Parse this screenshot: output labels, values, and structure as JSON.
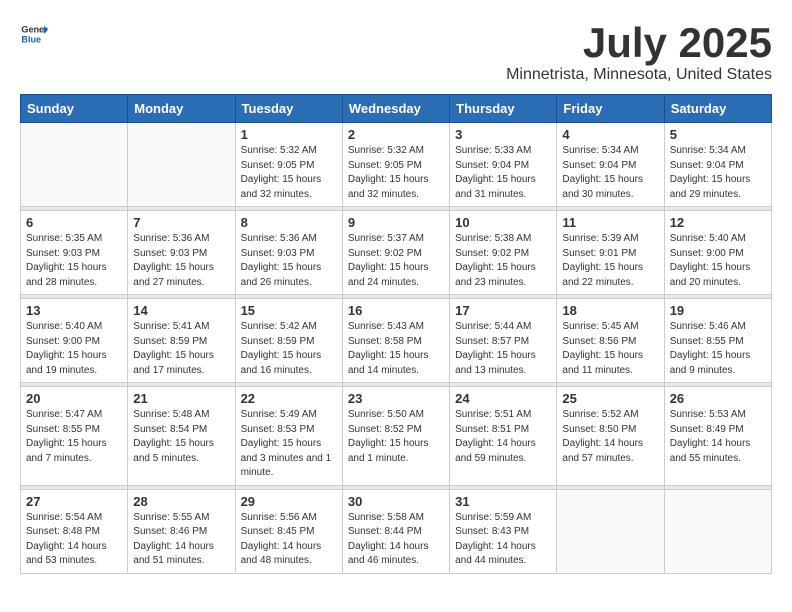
{
  "logo": {
    "general": "General",
    "blue": "Blue"
  },
  "title": "July 2025",
  "subtitle": "Minnetrista, Minnesota, United States",
  "days_of_week": [
    "Sunday",
    "Monday",
    "Tuesday",
    "Wednesday",
    "Thursday",
    "Friday",
    "Saturday"
  ],
  "weeks": [
    [
      {
        "day": "",
        "detail": ""
      },
      {
        "day": "",
        "detail": ""
      },
      {
        "day": "1",
        "detail": "Sunrise: 5:32 AM\nSunset: 9:05 PM\nDaylight: 15 hours\nand 32 minutes."
      },
      {
        "day": "2",
        "detail": "Sunrise: 5:32 AM\nSunset: 9:05 PM\nDaylight: 15 hours\nand 32 minutes."
      },
      {
        "day": "3",
        "detail": "Sunrise: 5:33 AM\nSunset: 9:04 PM\nDaylight: 15 hours\nand 31 minutes."
      },
      {
        "day": "4",
        "detail": "Sunrise: 5:34 AM\nSunset: 9:04 PM\nDaylight: 15 hours\nand 30 minutes."
      },
      {
        "day": "5",
        "detail": "Sunrise: 5:34 AM\nSunset: 9:04 PM\nDaylight: 15 hours\nand 29 minutes."
      }
    ],
    [
      {
        "day": "6",
        "detail": "Sunrise: 5:35 AM\nSunset: 9:03 PM\nDaylight: 15 hours\nand 28 minutes."
      },
      {
        "day": "7",
        "detail": "Sunrise: 5:36 AM\nSunset: 9:03 PM\nDaylight: 15 hours\nand 27 minutes."
      },
      {
        "day": "8",
        "detail": "Sunrise: 5:36 AM\nSunset: 9:03 PM\nDaylight: 15 hours\nand 26 minutes."
      },
      {
        "day": "9",
        "detail": "Sunrise: 5:37 AM\nSunset: 9:02 PM\nDaylight: 15 hours\nand 24 minutes."
      },
      {
        "day": "10",
        "detail": "Sunrise: 5:38 AM\nSunset: 9:02 PM\nDaylight: 15 hours\nand 23 minutes."
      },
      {
        "day": "11",
        "detail": "Sunrise: 5:39 AM\nSunset: 9:01 PM\nDaylight: 15 hours\nand 22 minutes."
      },
      {
        "day": "12",
        "detail": "Sunrise: 5:40 AM\nSunset: 9:00 PM\nDaylight: 15 hours\nand 20 minutes."
      }
    ],
    [
      {
        "day": "13",
        "detail": "Sunrise: 5:40 AM\nSunset: 9:00 PM\nDaylight: 15 hours\nand 19 minutes."
      },
      {
        "day": "14",
        "detail": "Sunrise: 5:41 AM\nSunset: 8:59 PM\nDaylight: 15 hours\nand 17 minutes."
      },
      {
        "day": "15",
        "detail": "Sunrise: 5:42 AM\nSunset: 8:59 PM\nDaylight: 15 hours\nand 16 minutes."
      },
      {
        "day": "16",
        "detail": "Sunrise: 5:43 AM\nSunset: 8:58 PM\nDaylight: 15 hours\nand 14 minutes."
      },
      {
        "day": "17",
        "detail": "Sunrise: 5:44 AM\nSunset: 8:57 PM\nDaylight: 15 hours\nand 13 minutes."
      },
      {
        "day": "18",
        "detail": "Sunrise: 5:45 AM\nSunset: 8:56 PM\nDaylight: 15 hours\nand 11 minutes."
      },
      {
        "day": "19",
        "detail": "Sunrise: 5:46 AM\nSunset: 8:55 PM\nDaylight: 15 hours\nand 9 minutes."
      }
    ],
    [
      {
        "day": "20",
        "detail": "Sunrise: 5:47 AM\nSunset: 8:55 PM\nDaylight: 15 hours\nand 7 minutes."
      },
      {
        "day": "21",
        "detail": "Sunrise: 5:48 AM\nSunset: 8:54 PM\nDaylight: 15 hours\nand 5 minutes."
      },
      {
        "day": "22",
        "detail": "Sunrise: 5:49 AM\nSunset: 8:53 PM\nDaylight: 15 hours and 3 minutes and 1 minute."
      },
      {
        "day": "23",
        "detail": "Sunrise: 5:50 AM\nSunset: 8:52 PM\nDaylight: 15 hours\nand 1 minute."
      },
      {
        "day": "24",
        "detail": "Sunrise: 5:51 AM\nSunset: 8:51 PM\nDaylight: 14 hours\nand 59 minutes."
      },
      {
        "day": "25",
        "detail": "Sunrise: 5:52 AM\nSunset: 8:50 PM\nDaylight: 14 hours\nand 57 minutes."
      },
      {
        "day": "26",
        "detail": "Sunrise: 5:53 AM\nSunset: 8:49 PM\nDaylight: 14 hours\nand 55 minutes."
      }
    ],
    [
      {
        "day": "27",
        "detail": "Sunrise: 5:54 AM\nSunset: 8:48 PM\nDaylight: 14 hours\nand 53 minutes."
      },
      {
        "day": "28",
        "detail": "Sunrise: 5:55 AM\nSunset: 8:46 PM\nDaylight: 14 hours\nand 51 minutes."
      },
      {
        "day": "29",
        "detail": "Sunrise: 5:56 AM\nSunset: 8:45 PM\nDaylight: 14 hours\nand 48 minutes."
      },
      {
        "day": "30",
        "detail": "Sunrise: 5:58 AM\nSunset: 8:44 PM\nDaylight: 14 hours\nand 46 minutes."
      },
      {
        "day": "31",
        "detail": "Sunrise: 5:59 AM\nSunset: 8:43 PM\nDaylight: 14 hours\nand 44 minutes."
      },
      {
        "day": "",
        "detail": ""
      },
      {
        "day": "",
        "detail": ""
      }
    ]
  ]
}
